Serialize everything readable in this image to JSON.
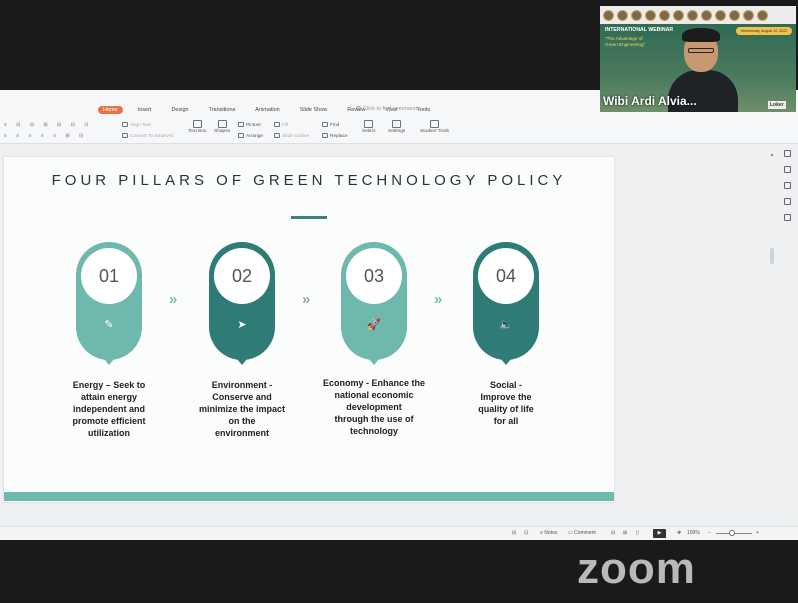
{
  "app": {
    "ribbon_tabs": [
      "Home",
      "Insert",
      "Design",
      "Transitions",
      "Animation",
      "Slide Show",
      "Review",
      "View",
      "Tools"
    ],
    "active_tab": "Home",
    "find_commands_placeholder": "Click to find commands",
    "tools": {
      "align_text": "Align Text",
      "convert_to_smartart": "Convert To SmartArt",
      "text_box": "Text Box",
      "shapes": "Shapes",
      "picture": "Picture",
      "arrange": "Arrange",
      "fill": "Fill",
      "outline": "Slide Outline",
      "find": "Find",
      "replace": "Replace",
      "select": "Select",
      "settings": "Settings",
      "student_tools": "Student Tools"
    }
  },
  "slide": {
    "title": "FOUR PILLARS OF GREEN TECHNOLOGY POLICY",
    "pillars": [
      {
        "number": "01",
        "icon": "notepad-icon",
        "glyph": "✎",
        "color": "#6fb8ae",
        "text": "Energy – Seek to\nattain energy\nindependent   and\npromote efficient\nutilization"
      },
      {
        "number": "02",
        "icon": "paper-plane-icon",
        "glyph": "➤",
        "color": "#2f7b76",
        "text": "Environment -\nConserve and\nminimize the impact\non the\nenvironment"
      },
      {
        "number": "03",
        "icon": "rocket-icon",
        "glyph": "🚀",
        "color": "#6fb8ae",
        "text": "Economy - Enhance the\nnational economic\ndevelopment\nthrough the use of\ntechnology"
      },
      {
        "number": "04",
        "icon": "speaker-icon",
        "glyph": "🔈",
        "color": "#2f7b76",
        "text": "Social -\nImprove the\nquality of life\nfor all"
      }
    ],
    "chevron": "»",
    "footer_color": "#6fb8ae"
  },
  "statusbar": {
    "notes": "Notes",
    "comment": "Comment",
    "zoom": "109%"
  },
  "zoom_logo": "zoom",
  "video": {
    "participant_name": "Wibi Ardi Alvia...",
    "webinar_label": "INTERNATIONAL WEBINAR",
    "webinar_title": "\"The Advantage of\nGreen Engineering\"",
    "date": "Wednesday, August 10, 2022",
    "brand": "Loker"
  }
}
